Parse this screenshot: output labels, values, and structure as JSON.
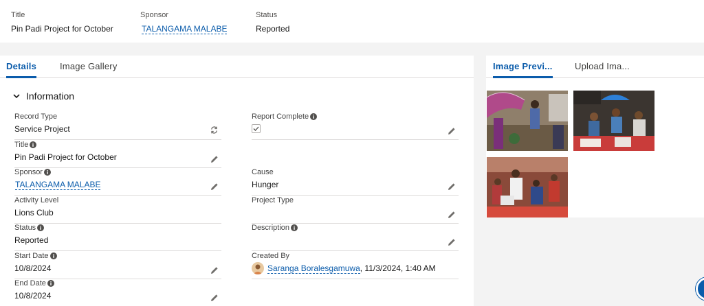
{
  "highlights": {
    "title_label": "Title",
    "title_value": "Pin Padi Project for October",
    "sponsor_label": "Sponsor",
    "sponsor_value": "TALANGAMA MALABE",
    "status_label": "Status",
    "status_value": "Reported"
  },
  "left_tabs": [
    {
      "label": "Details",
      "active": true
    },
    {
      "label": "Image Gallery",
      "active": false
    }
  ],
  "section": {
    "title": "Information"
  },
  "fields_left": [
    {
      "label": "Record Type",
      "value": "Service Project",
      "info": false,
      "action": "sync-icon"
    },
    {
      "label": "Title",
      "value": "Pin Padi Project for October",
      "info": true,
      "action": "pencil-icon"
    },
    {
      "label": "Sponsor",
      "value": "TALANGAMA MALABE",
      "info": true,
      "action": "pencil-icon",
      "link": true
    },
    {
      "label": "Activity Level",
      "value": "Lions Club",
      "info": false,
      "action": ""
    },
    {
      "label": "Status",
      "value": "Reported",
      "info": true,
      "action": ""
    },
    {
      "label": "Start Date",
      "value": "10/8/2024",
      "info": true,
      "action": "pencil-icon"
    },
    {
      "label": "End Date",
      "value": "10/8/2024",
      "info": true,
      "action": "pencil-icon"
    }
  ],
  "fields_right": [
    {
      "label": "Report Complete",
      "value": "",
      "info": true,
      "checkbox": true,
      "checked": true
    },
    {
      "label": "Cause",
      "value": "Hunger",
      "info": false
    },
    {
      "label": "Project Type",
      "value": "",
      "info": false
    },
    {
      "label": "Description",
      "value": "",
      "info": true
    },
    {
      "label": "Created By",
      "user": "Saranga Boralesgamuwa",
      "timestamp": ", 11/3/2024, 1:40 AM",
      "info": false
    }
  ],
  "right_tabs": [
    {
      "label": "Image Previ...",
      "active": true
    },
    {
      "label": "Upload Ima...",
      "active": false
    }
  ],
  "images": [
    {
      "name": "photo-umbrellas",
      "accent": "#b04a8a"
    },
    {
      "name": "photo-crowd-blue-umbrella",
      "accent": "#2d7fd6"
    },
    {
      "name": "photo-distribution",
      "accent": "#c23a2f"
    }
  ],
  "colors": {
    "accent": "#0b5cab",
    "border": "#dddbda",
    "page_bg": "#f3f3f3"
  }
}
